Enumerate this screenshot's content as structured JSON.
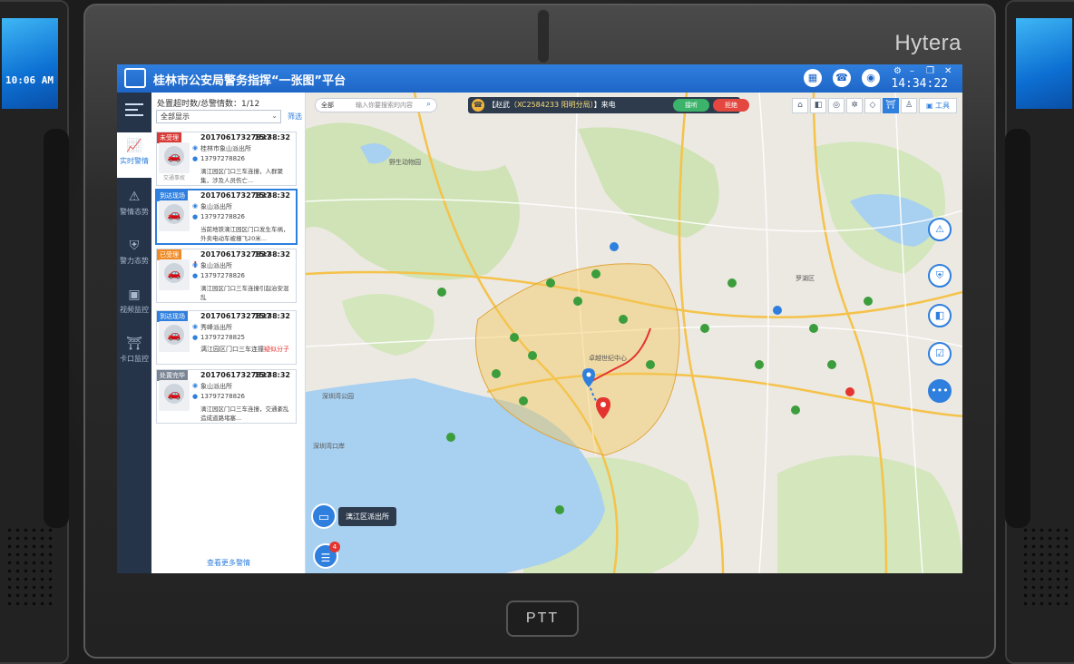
{
  "device": {
    "brand": "Hytera",
    "ptt_label": "PTT",
    "left_screen_time": "10:06 AM"
  },
  "app": {
    "title": "桂林市公安局警务指挥“一张图”平台",
    "clock": "14:34:22"
  },
  "nav": [
    {
      "label": "实时警情",
      "icon": "chart-icon",
      "active": true
    },
    {
      "label": "警情态势",
      "icon": "alert-icon",
      "active": false
    },
    {
      "label": "警力态势",
      "icon": "police-badge-icon",
      "active": false
    },
    {
      "label": "视频监控",
      "icon": "video-icon",
      "active": false
    },
    {
      "label": "卡口监控",
      "icon": "checkpoint-icon",
      "active": false
    }
  ],
  "alert_panel": {
    "header": "处置超时数/总警情数：1/12",
    "filter_value": "全部显示",
    "filter_link": "筛选",
    "more_link": "查看更多警情",
    "alerts": [
      {
        "status": "未受理",
        "status_color": "#d93a35",
        "id": "20170617327837",
        "time": "15:38:32",
        "location": "桂林市象山派出所",
        "phone": "13797278826",
        "desc": "漓江园区门口三车连撞，人群聚集，涉及人员伤亡...",
        "thumb_label": "交通事故",
        "selected": false
      },
      {
        "status": "到达现场",
        "status_color": "#2f7fde",
        "id": "20170617327837",
        "time": "15:38:32",
        "location": "象山派出所",
        "phone": "13797278826",
        "desc": "当前地铁漓江园区门口发生车祸，外卖电动车被撞飞20米...",
        "thumb_label": "",
        "selected": true
      },
      {
        "status": "已受理",
        "status_color": "#f08a24",
        "id": "20170617327837",
        "time": "15:38:32",
        "location": "象山派出所",
        "phone": "13797278826",
        "desc": "漓江园区门口三车连撞引起治安混乱",
        "thumb_label": "",
        "selected": false
      },
      {
        "status": "到达现场",
        "status_color": "#2f7fde",
        "id": "20170617327837",
        "time": "15:38:32",
        "location": "秀峰派出所",
        "phone": "13797278825",
        "desc": "漓江园区门口三车连撞",
        "desc_highlight": "疑似分子",
        "thumb_label": "",
        "selected": false
      },
      {
        "status": "处置完毕",
        "status_color": "#7a8594",
        "id": "20170617327837",
        "time": "15:38:32",
        "location": "象山派出所",
        "phone": "13797278826",
        "desc": "漓江园区门口三车连撞，交通紊乱造成道路堵塞...",
        "thumb_label": "",
        "selected": false
      }
    ]
  },
  "map": {
    "search_scope": "全部",
    "search_placeholder": "输入你要搜索的内容",
    "call": {
      "caller": "【赵武",
      "number": "（XC2584233 阳明分局）",
      "suffix": "】来电",
      "accept": "接听",
      "reject": "拒绝"
    },
    "tools_label": "工具",
    "station_tip": "漓江区派出所",
    "message_badge": "4",
    "labels": [
      {
        "text": "野生动物园"
      },
      {
        "text": "深圳湾口岸"
      },
      {
        "text": "卓越世纪中心"
      },
      {
        "text": "罗湖区"
      },
      {
        "text": "深圳湾公园"
      }
    ]
  },
  "colors": {
    "accent": "#2f7fde",
    "nav_bg": "#26344a",
    "map_water": "#a8d0f0",
    "map_green": "#c8dfb0"
  }
}
